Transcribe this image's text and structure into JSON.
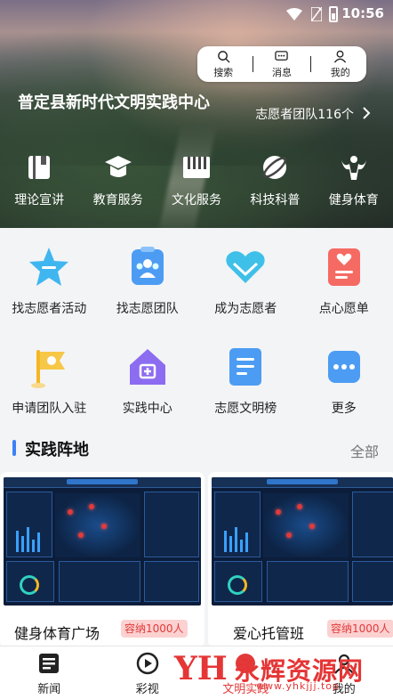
{
  "status_bar": {
    "time": "10:56"
  },
  "top_actions": [
    {
      "label": "搜索",
      "icon": "search-icon"
    },
    {
      "label": "消息",
      "icon": "message-icon"
    },
    {
      "label": "我的",
      "icon": "user-icon"
    }
  ],
  "hero": {
    "title": "普定县新时代文明实践中心",
    "volunteer_teams": "志愿者团队116个"
  },
  "categories": [
    {
      "label": "理论宣讲",
      "icon": "book-icon"
    },
    {
      "label": "教育服务",
      "icon": "graduation-cap-icon"
    },
    {
      "label": "文化服务",
      "icon": "piano-icon"
    },
    {
      "label": "科技科普",
      "icon": "planet-icon"
    },
    {
      "label": "健身体育",
      "icon": "bodybuilder-icon"
    }
  ],
  "services": [
    {
      "label": "找志愿者活动",
      "icon": "star-icon"
    },
    {
      "label": "找志愿团队",
      "icon": "team-icon"
    },
    {
      "label": "成为志愿者",
      "icon": "heart-hands-icon"
    },
    {
      "label": "点心愿单",
      "icon": "wish-list-icon"
    },
    {
      "label": "申请团队入驻",
      "icon": "flag-icon"
    },
    {
      "label": "实践中心",
      "icon": "house-icon"
    },
    {
      "label": "志愿文明榜",
      "icon": "document-icon"
    },
    {
      "label": "更多",
      "icon": "more-icon"
    }
  ],
  "section": {
    "title": "实践阵地",
    "all_label": "全部"
  },
  "venues": [
    {
      "name": "健身体育广场",
      "capacity": "容纳1000人"
    },
    {
      "name": "爱心托管班",
      "capacity": "容纳1000人"
    }
  ],
  "bottom_nav": [
    {
      "label": "新闻",
      "icon": "news-icon"
    },
    {
      "label": "彩视",
      "icon": "play-icon"
    },
    {
      "label": "文明实践",
      "icon": "civilization-icon"
    },
    {
      "label": "我的",
      "icon": "profile-icon"
    }
  ],
  "watermark": {
    "brand": "永辉资源网",
    "url": "www.yhkjjj.top"
  },
  "colors": {
    "accent": "#3b82f6",
    "badge_bg": "#fbd1d1",
    "badge_text": "#e23a3a"
  }
}
